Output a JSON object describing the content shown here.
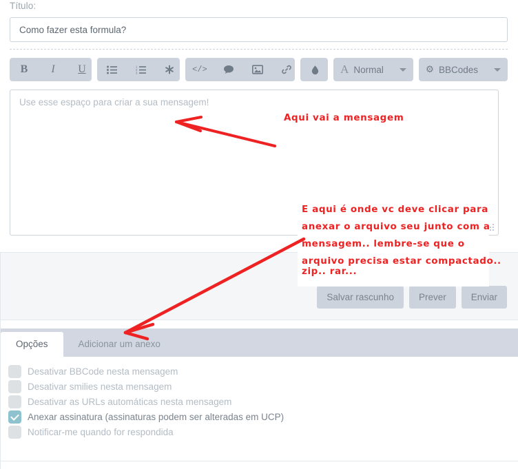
{
  "form": {
    "title_label": "Título:",
    "title_value": "Como fazer esta formula?",
    "editor_placeholder": "Use esse espaço para criar a sua mensagem!"
  },
  "toolbar": {
    "groups": [
      {
        "name": "text-style",
        "buttons": [
          {
            "name": "bold-button",
            "label": "B",
            "icon": "bold-icon"
          },
          {
            "name": "italic-button",
            "label": "I",
            "icon": "italic-icon"
          },
          {
            "name": "underline-button",
            "label": "U",
            "icon": "underline-icon"
          }
        ]
      },
      {
        "name": "lists",
        "buttons": [
          {
            "name": "unordered-list-button",
            "label": "",
            "icon": "bullet-list-icon"
          },
          {
            "name": "ordered-list-button",
            "label": "",
            "icon": "numbered-list-icon"
          },
          {
            "name": "list-item-button",
            "label": "",
            "icon": "asterisk-icon"
          }
        ]
      },
      {
        "name": "insert",
        "buttons": [
          {
            "name": "code-button",
            "label": "</>",
            "icon": "code-icon"
          },
          {
            "name": "quote-button",
            "label": "",
            "icon": "speech-bubble-icon"
          },
          {
            "name": "image-button",
            "label": "",
            "icon": "image-icon"
          },
          {
            "name": "link-button",
            "label": "",
            "icon": "link-icon"
          }
        ]
      },
      {
        "name": "color",
        "buttons": [
          {
            "name": "text-color-button",
            "label": "",
            "icon": "droplet-icon"
          }
        ]
      }
    ],
    "font_size_label": "Normal",
    "bbcodes_label": "BBCodes"
  },
  "actions": {
    "save_draft_label": "Salvar rascunho",
    "preview_label": "Prever",
    "submit_label": "Enviar"
  },
  "tabs": [
    {
      "name": "tab-opcoes",
      "label": "Opções",
      "active": true
    },
    {
      "name": "tab-adicionar-anexo",
      "label": "Adicionar um anexo",
      "active": false
    }
  ],
  "options": [
    {
      "label": "Desativar BBCode nesta mensagem",
      "checked": false
    },
    {
      "label": "Desativar smilies nesta mensagem",
      "checked": false
    },
    {
      "label": "Desativar as URLs automáticas nesta mensagem",
      "checked": false
    },
    {
      "label": "Anexar assinatura (assinaturas podem ser alteradas em UCP)",
      "checked": true
    },
    {
      "label": "Notificar-me quando for respondida",
      "checked": false
    }
  ],
  "annotations": {
    "color": "#ee2222",
    "note_message": "Aqui vai a mensagem",
    "note_attach_line1": "E aqui é onde vc deve clicar para",
    "note_attach_line2": "anexar o arquivo seu junto com a",
    "note_attach_line3": "mensagem.. lembre-se que o",
    "note_attach_line4": "arquivo precisa estar compactado..",
    "note_attach_line5": "zip.. rar..."
  },
  "colors": {
    "toolbar_bg": "#cdd3dd",
    "tab_strip_bg": "#d2d7e2",
    "checkbox_checked": "#8ec2ce",
    "annotation_red": "#ee2222",
    "muted_text": "#b3bcc4"
  }
}
